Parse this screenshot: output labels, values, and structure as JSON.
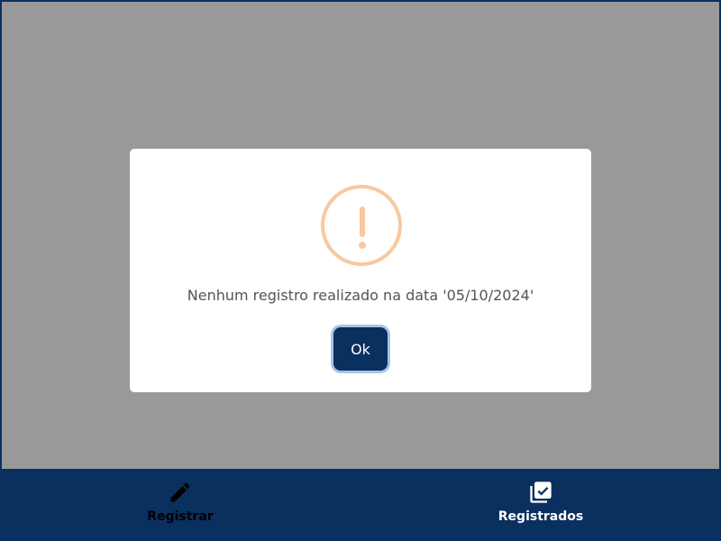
{
  "dialog": {
    "icon": "warning-icon",
    "message": "Nenhum registro realizado na data '05/10/2024'",
    "ok_label": "Ok"
  },
  "bottom_nav": {
    "items": [
      {
        "label": "Registrar",
        "icon": "pencil-icon",
        "active": false
      },
      {
        "label": "Registrados",
        "icon": "checklist-icon",
        "active": true
      }
    ]
  },
  "colors": {
    "primary": "#09305f",
    "warning": "#f8c9a0",
    "overlay": "#9a9a9a",
    "message_text": "#545454"
  }
}
